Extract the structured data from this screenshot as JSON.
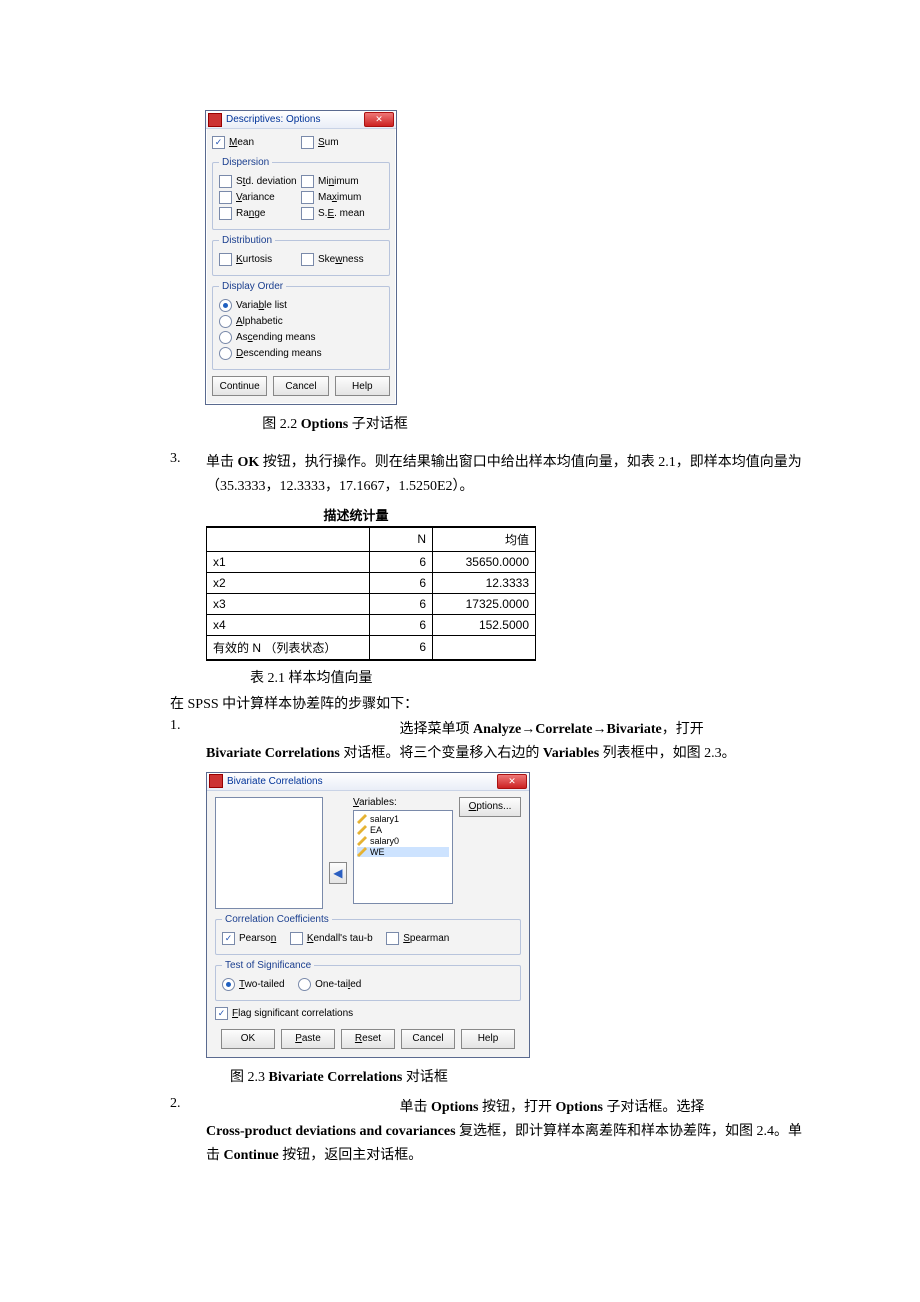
{
  "dialog1": {
    "title": "Descriptives: Options",
    "mean": "Mean",
    "sum": "Sum",
    "groups": {
      "dispersion": {
        "legend": "Dispersion",
        "std": "Std. deviation",
        "min": "Minimum",
        "var": "Variance",
        "max": "Maximum",
        "range": "Range",
        "se": "S.E. mean"
      },
      "distribution": {
        "legend": "Distribution",
        "kurt": "Kurtosis",
        "skew": "Skewness"
      },
      "display": {
        "legend": "Display Order",
        "varlist": "Variable list",
        "alpha": "Alphabetic",
        "asc": "Ascending means",
        "desc": "Descending means"
      }
    },
    "buttons": {
      "cont": "Continue",
      "cancel": "Cancel",
      "help": "Help"
    }
  },
  "caption1": {
    "pre": "图 2.2 ",
    "bold": "Options",
    "post": " 子对话框"
  },
  "step3": {
    "num": "3.",
    "text_a": "单击 ",
    "ok": "OK",
    "text_b": " 按钮，执行操作。则在结果输出窗口中给出样本均值向量，如表 2.1，即样本均值向量为（35.3333，12.3333，17.1667，1.5250E2）。"
  },
  "table": {
    "title": "描述统计量",
    "headers": {
      "name": "",
      "n": "N",
      "mean": "均值"
    },
    "rows": [
      {
        "name": "x1",
        "n": "6",
        "mean": "35650.0000"
      },
      {
        "name": "x2",
        "n": "6",
        "mean": "12.3333"
      },
      {
        "name": "x3",
        "n": "6",
        "mean": "17325.0000"
      },
      {
        "name": "x4",
        "n": "6",
        "mean": "152.5000"
      },
      {
        "name": "有效的 N （列表状态）",
        "n": "6",
        "mean": ""
      }
    ],
    "caption": "表 2.1   样本均值向量"
  },
  "para1": "在 SPSS 中计算样本协差阵的步骤如下：",
  "step_b1": {
    "num": "1.",
    "t1": "选择菜单项 ",
    "m1": "Analyze",
    "arrow1": "→",
    "m2": "Correlate",
    "arrow2": "→",
    "m3": "Bivariate",
    "t2": "，打开 ",
    "bc": "Bivariate Correlations",
    "t3": " 对话框。将三个变量移入右边的 ",
    "vars": "Variables",
    "t4": " 列表框中，如图 2.3。"
  },
  "dialog2": {
    "title": "Bivariate Correlations",
    "varlabel": "Variables:",
    "options": "Options...",
    "vars": [
      "salary1",
      "EA",
      "salary0",
      "WE"
    ],
    "cc": {
      "legend": "Correlation Coefficients",
      "pearson": "Pearson",
      "kendall": "Kendall's tau-b",
      "spear": "Spearman"
    },
    "tos": {
      "legend": "Test of Significance",
      "two": "Two-tailed",
      "one": "One-tailed"
    },
    "flag": "Flag significant correlations",
    "buttons": {
      "ok": "OK",
      "paste": "Paste",
      "reset": "Reset",
      "cancel": "Cancel",
      "help": "Help"
    }
  },
  "caption3": {
    "pre": "图 2.3 ",
    "bold": "Bivariate Correlations",
    "post": " 对话框"
  },
  "step_b2": {
    "num": "2.",
    "t1": "单击 ",
    "opt": "Options",
    "t2": " 按钮，打开 ",
    "opt2": "Options",
    "t3": " 子对话框。选择 ",
    "cp": "Cross-product deviations and covariances",
    "t4": " 复选框，即计算样本离差阵和样本协差阵，如图 2.4。单击 ",
    "cont": "Continue",
    "t5": " 按钮，返回主对话框。"
  }
}
